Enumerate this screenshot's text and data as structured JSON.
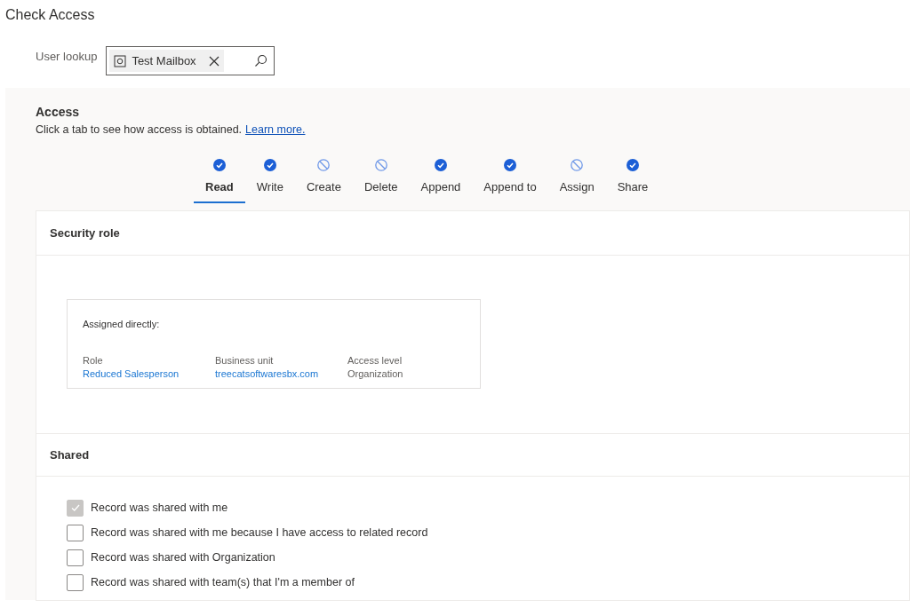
{
  "page_title": "Check Access",
  "user_lookup": {
    "label": "User lookup",
    "value": "Test Mailbox"
  },
  "access": {
    "heading": "Access",
    "description": "Click a tab to see how access is obtained.",
    "link": "Learn more."
  },
  "tabs": [
    {
      "label": "Read",
      "allowed": true,
      "selected": true
    },
    {
      "label": "Write",
      "allowed": true,
      "selected": false
    },
    {
      "label": "Create",
      "allowed": false,
      "selected": false
    },
    {
      "label": "Delete",
      "allowed": false,
      "selected": false
    },
    {
      "label": "Append",
      "allowed": true,
      "selected": false
    },
    {
      "label": "Append to",
      "allowed": true,
      "selected": false
    },
    {
      "label": "Assign",
      "allowed": false,
      "selected": false
    },
    {
      "label": "Share",
      "allowed": true,
      "selected": false
    }
  ],
  "security_role": {
    "heading": "Security role",
    "card_title": "Assigned directly:",
    "fields": [
      {
        "label": "Role",
        "value": "Reduced Salesperson",
        "kind": "link"
      },
      {
        "label": "Business unit",
        "value": "treecatsoftwaresbx.com",
        "kind": "link"
      },
      {
        "label": "Access level",
        "value": "Organization",
        "kind": "text"
      }
    ]
  },
  "shared": {
    "heading": "Shared",
    "options": [
      {
        "label": "Record was shared with me",
        "checked": true,
        "disabled": true
      },
      {
        "label": "Record was shared with me because I have access to related record",
        "checked": false,
        "disabled": false
      },
      {
        "label": "Record was shared with Organization",
        "checked": false,
        "disabled": false
      },
      {
        "label": "Record was shared with team(s) that I'm a member of",
        "checked": false,
        "disabled": false
      }
    ]
  }
}
